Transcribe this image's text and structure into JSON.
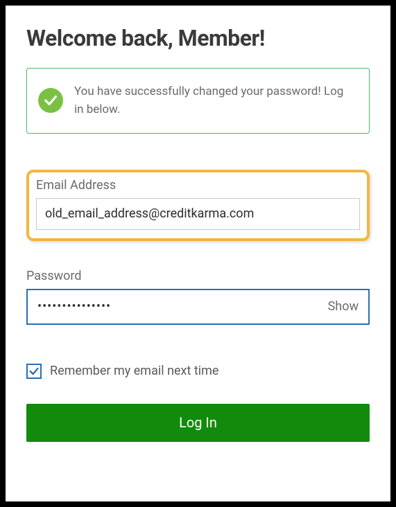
{
  "page": {
    "title": "Welcome back, Member!"
  },
  "alert": {
    "message": "You have successfully changed your password! Log in below."
  },
  "email": {
    "label": "Email Address",
    "value": "old_email_address@creditkarma.com"
  },
  "password": {
    "label": "Password",
    "value": "•••••••••••••••",
    "toggle_label": "Show"
  },
  "remember": {
    "label": "Remember my email next time",
    "checked": true
  },
  "submit": {
    "label": "Log In"
  },
  "colors": {
    "success_border": "#4bb76a",
    "check_bg": "#7ac143",
    "highlight": "#f3b63f",
    "focus_blue": "#2a6db5",
    "button_green": "#128a0c"
  }
}
